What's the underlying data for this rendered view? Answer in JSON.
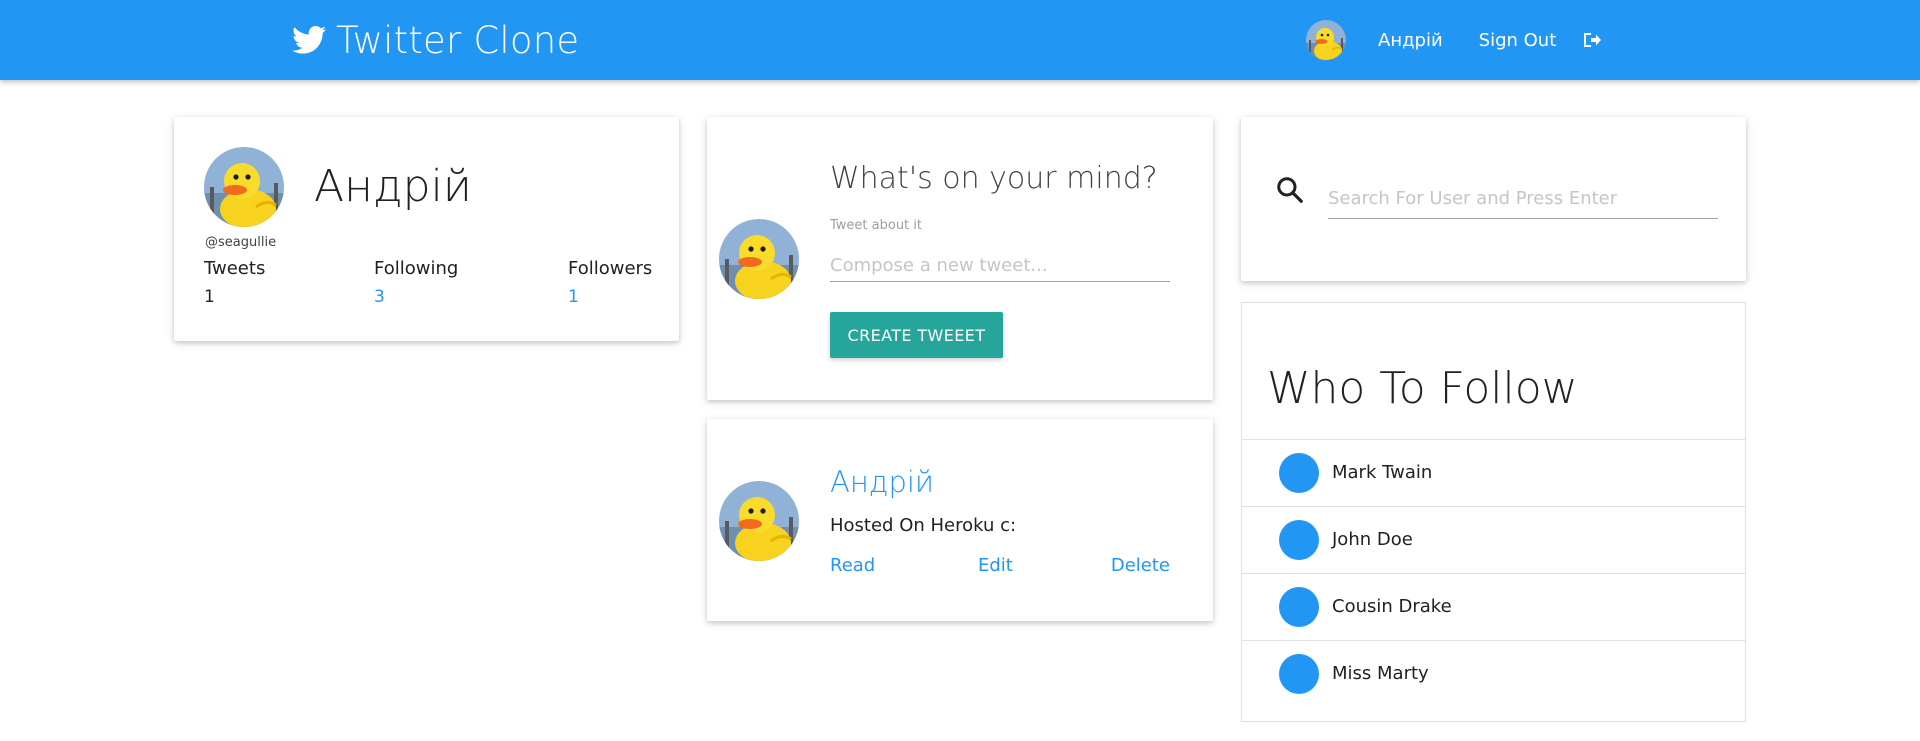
{
  "navbar": {
    "brand": "Twitter Clone",
    "user_name": "Андрій",
    "sign_out": "Sign Out",
    "color": "#2196f3"
  },
  "profile": {
    "name": "Андрій",
    "handle": "@seagullie",
    "stats": [
      {
        "label": "Tweets",
        "value": "1"
      },
      {
        "label": "Following",
        "value": "3"
      },
      {
        "label": "Followers",
        "value": "1"
      }
    ]
  },
  "compose": {
    "title": "What's on your mind?",
    "label": "Tweet about it",
    "placeholder": "Compose a new tweet...",
    "button": "CREATE TWEEET",
    "button_color": "#26a69a"
  },
  "tweet": {
    "author": "Андрій",
    "text": "Hosted On Heroku c:",
    "actions": {
      "read": "Read",
      "edit": "Edit",
      "delete": "Delete"
    }
  },
  "search": {
    "placeholder": "Search For User and Press Enter",
    "icon": "search-icon"
  },
  "who_to_follow": {
    "title": "Who To Follow",
    "users": [
      {
        "name": "Mark Twain"
      },
      {
        "name": "John Doe"
      },
      {
        "name": "Cousin Drake"
      },
      {
        "name": "Miss Marty"
      }
    ]
  }
}
